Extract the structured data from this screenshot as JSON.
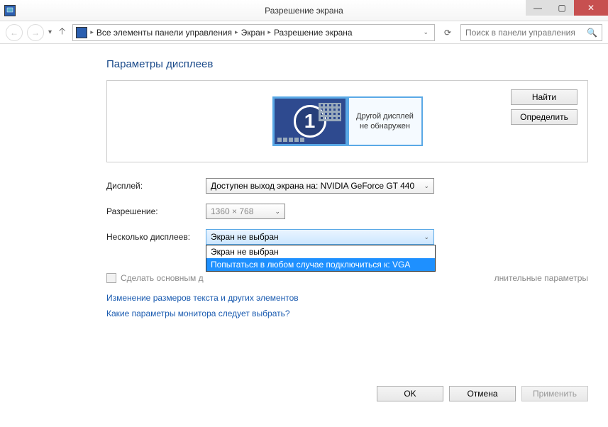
{
  "window": {
    "title": "Разрешение экрана"
  },
  "winbtns": {
    "min": "—",
    "max": "▢",
    "close": "✕"
  },
  "breadcrumb": {
    "root": "Все элементы панели управления",
    "seg2": "Экран",
    "seg3": "Разрешение экрана"
  },
  "search": {
    "placeholder": "Поиск в панели управления"
  },
  "heading": "Параметры дисплеев",
  "monitor": {
    "primary_id": "1",
    "secondary_text": "Другой дисплей\nне обнаружен"
  },
  "side_btns": {
    "find": "Найти",
    "identify": "Определить"
  },
  "form": {
    "display_label": "Дисплей:",
    "display_value": "Доступен выход экрана на: NVIDIA GeForce GT 440",
    "resolution_label": "Разрешение:",
    "resolution_value": "1360 × 768",
    "multi_label": "Несколько дисплеев:",
    "multi_value": "Экран не выбран",
    "multi_options": {
      "opt0": "Экран не выбран",
      "opt1": "Попытаться в любом случае подключиться к: VGA"
    }
  },
  "checkbox_label": "Сделать основным д",
  "trail_text": "лнительные параметры",
  "links": {
    "l1": "Изменение размеров текста и других элементов",
    "l2": "Какие параметры монитора следует выбрать?"
  },
  "footer": {
    "ok": "OK",
    "cancel": "Отмена",
    "apply": "Применить"
  }
}
